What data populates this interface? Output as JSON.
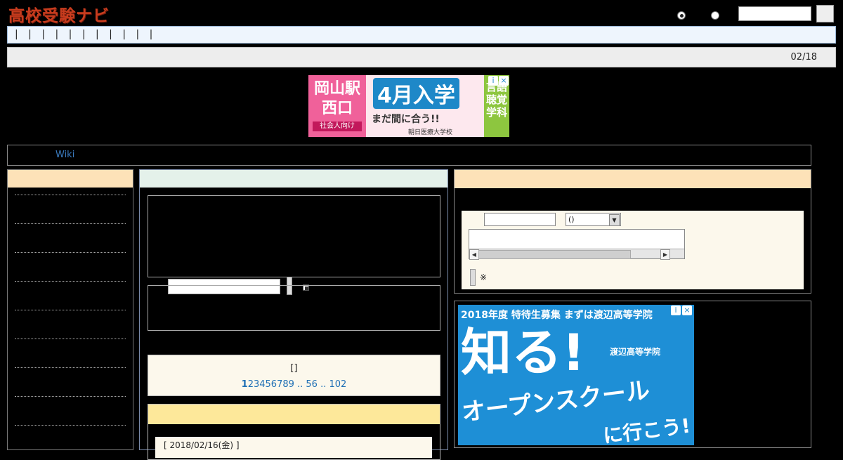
{
  "header": {
    "logo": "高校受験ナビ"
  },
  "nav": {
    "text": "| | | | | | | | | | |"
  },
  "info_bar": {
    "date": "02/18"
  },
  "ad_top": {
    "left_text": "岡山駅西口",
    "left_sub": "社会人向け",
    "headline": "4月入学",
    "sub": "まだ間に合う!!",
    "school": "朝日医療大学校",
    "right_text": "言語聴覚学科"
  },
  "wiki_bar": {
    "link": "Wiki"
  },
  "pager": {
    "label": "[]",
    "current": "1",
    "links": "23456789 .. 56 .. 102"
  },
  "post": {
    "item": "[ 2018/02/16(金) ]"
  },
  "form": {
    "mail_option": "()",
    "note": "※"
  },
  "ad_right": {
    "headline": "2018年度 特待生募集 まずは渡辺高等学院",
    "big": "知る!",
    "school": "渡辺高等学院",
    "open": "オープンスクール",
    "go": "に行こう!"
  },
  "colors": {
    "logo": "#c83c1e",
    "link": "#1e6fb5",
    "nav_bg": "#eef5fd",
    "panel_head": "#fde2b8",
    "center_head": "#e4f1ea",
    "post_head": "#fde89a"
  }
}
